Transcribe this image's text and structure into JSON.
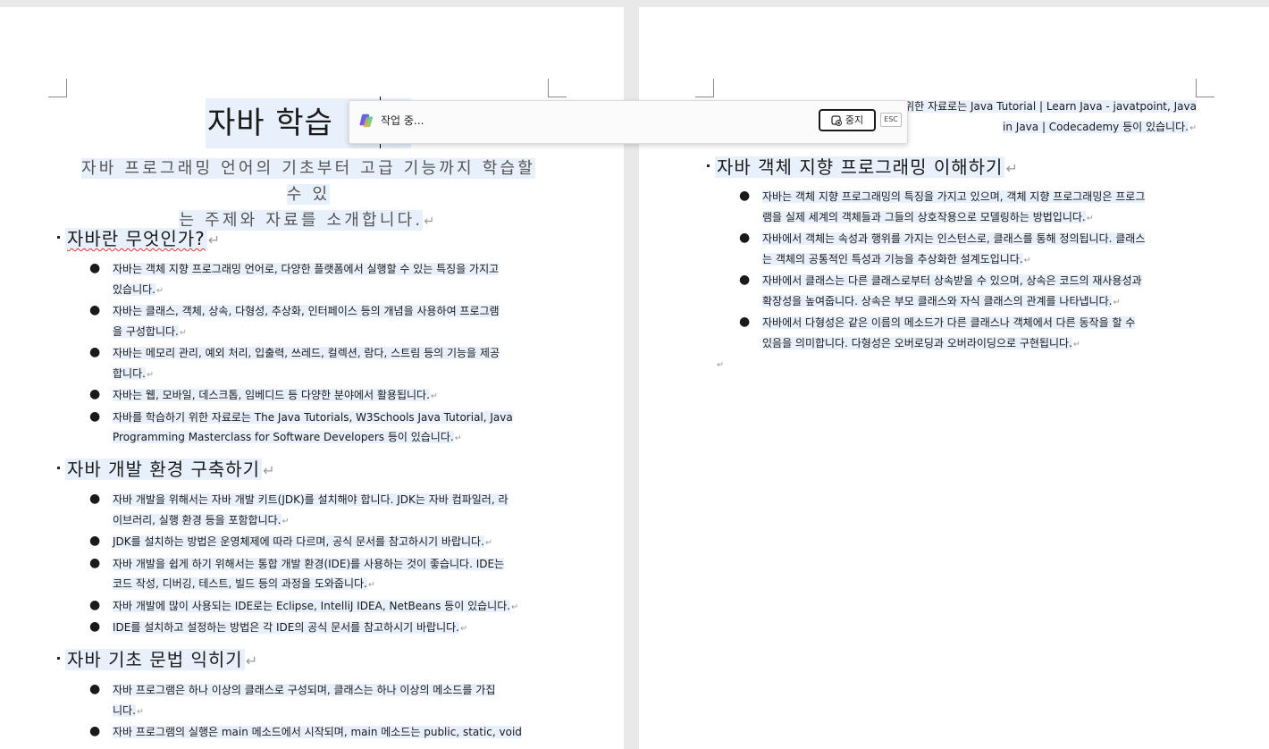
{
  "document": {
    "title": "자바 학습",
    "subtitle_line1": "자바 프로그래밍 언어의 기초부터 고급 기능까지 학습할 수 있",
    "subtitle_line2": "는 주제와 자료를 소개합니다.",
    "sections": [
      {
        "heading": "자바란 무엇인가?",
        "items": [
          [
            "자바는 객체 지향 프로그래밍 언어로, 다양한 플랫폼에서 실행할 수 있는 특징을 가지고",
            "있습니다."
          ],
          [
            "자바는 클래스, 객체, 상속, 다형성, 추상화, 인터페이스 등의 개념을 사용하여 프로그램",
            "을 구성합니다."
          ],
          [
            "자바는 메모리 관리, 예외 처리, 입출력, 쓰레드, 컬렉션, 람다, 스트림 등의 기능을 제공",
            "합니다."
          ],
          [
            "자바는 웹, 모바일, 데스크톱, 임베디드 등 다양한 분야에서 활용됩니다."
          ],
          [
            "자바를 학습하기 위한 자료로는 The Java Tutorials, W3Schools Java Tutorial, Java",
            "Programming Masterclass for Software Developers 등이 있습니다."
          ]
        ]
      },
      {
        "heading": "자바 개발 환경 구축하기",
        "items": [
          [
            "자바 개발을 위해서는 자바 개발 키트(JDK)를 설치해야 합니다. JDK는 자바 컴파일러, 라",
            "이브러리, 실행 환경 등을 포함합니다."
          ],
          [
            "JDK를 설치하는 방법은 운영체제에 따라 다르며, 공식 문서를 참고하시기 바랍니다."
          ],
          [
            "자바 개발을 쉽게 하기 위해서는 통합 개발 환경(IDE)를 사용하는 것이 좋습니다. IDE는",
            "코드 작성, 디버깅, 테스트, 빌드 등의 과정을 도와줍니다."
          ],
          [
            "자바 개발에 많이 사용되는 IDE로는 Eclipse, IntelliJ IDEA, NetBeans 등이 있습니다."
          ],
          [
            "IDE를 설치하고 설정하는 방법은 각 IDE의 공식 문서를 참고하시기 바랍니다."
          ]
        ]
      },
      {
        "heading": "자바 기초 문법 익히기",
        "items": [
          [
            "자바 프로그램은 하나 이상의 클래스로 구성되며, 클래스는 하나 이상의 메소드를 가집",
            "니다."
          ],
          [
            "자바 프로그램의 실행은 main 메소드에서 시작되며, main 메소드는 public, static, void"
          ]
        ]
      }
    ],
    "page2_top_line1": "위한 자료로는 Java Tutorial | Learn Java - javatpoint, Java",
    "page2_top_line2": "in Java | Codecademy 등이 있습니다.",
    "page2_sections": [
      {
        "heading": "자바 객체 지향 프로그래밍 이해하기",
        "items": [
          [
            "자바는 객체 지향 프로그래밍의 특징을 가지고 있으며, 객체 지향 프로그래밍은 프로그",
            "램을 실제 세계의 객체들과 그들의 상호작용으로 모델링하는 방법입니다."
          ],
          [
            "자바에서 객체는 속성과 행위를 가지는 인스턴스로, 클래스를 통해 정의됩니다. 클래스",
            "는 객체의 공통적인 특성과 기능을 추상화한 설계도입니다."
          ],
          [
            "자바에서 클래스는 다른 클래스로부터 상속받을 수 있으며, 상속은 코드의 재사용성과",
            "확장성을 높여줍니다. 상속은 부모 클래스와 자식 클래스의 관계를 나타냅니다."
          ],
          [
            "자바에서 다형성은 같은 이름의 메소드가 다른 클래스나 객체에서 다른 동작을 할 수",
            "있음을 의미합니다. 다형성은 오버로딩과 오버라이딩으로 구현됩니다."
          ]
        ]
      }
    ]
  },
  "copilot_bar": {
    "status": "작업 중...",
    "stop_label": "중지",
    "esc_label": "ESC"
  },
  "symbols": {
    "paragraph_mark": "↵",
    "bullet": "●"
  },
  "colors": {
    "selection_highlight": "#e8f0fb",
    "spell_error": "#e0312f"
  }
}
